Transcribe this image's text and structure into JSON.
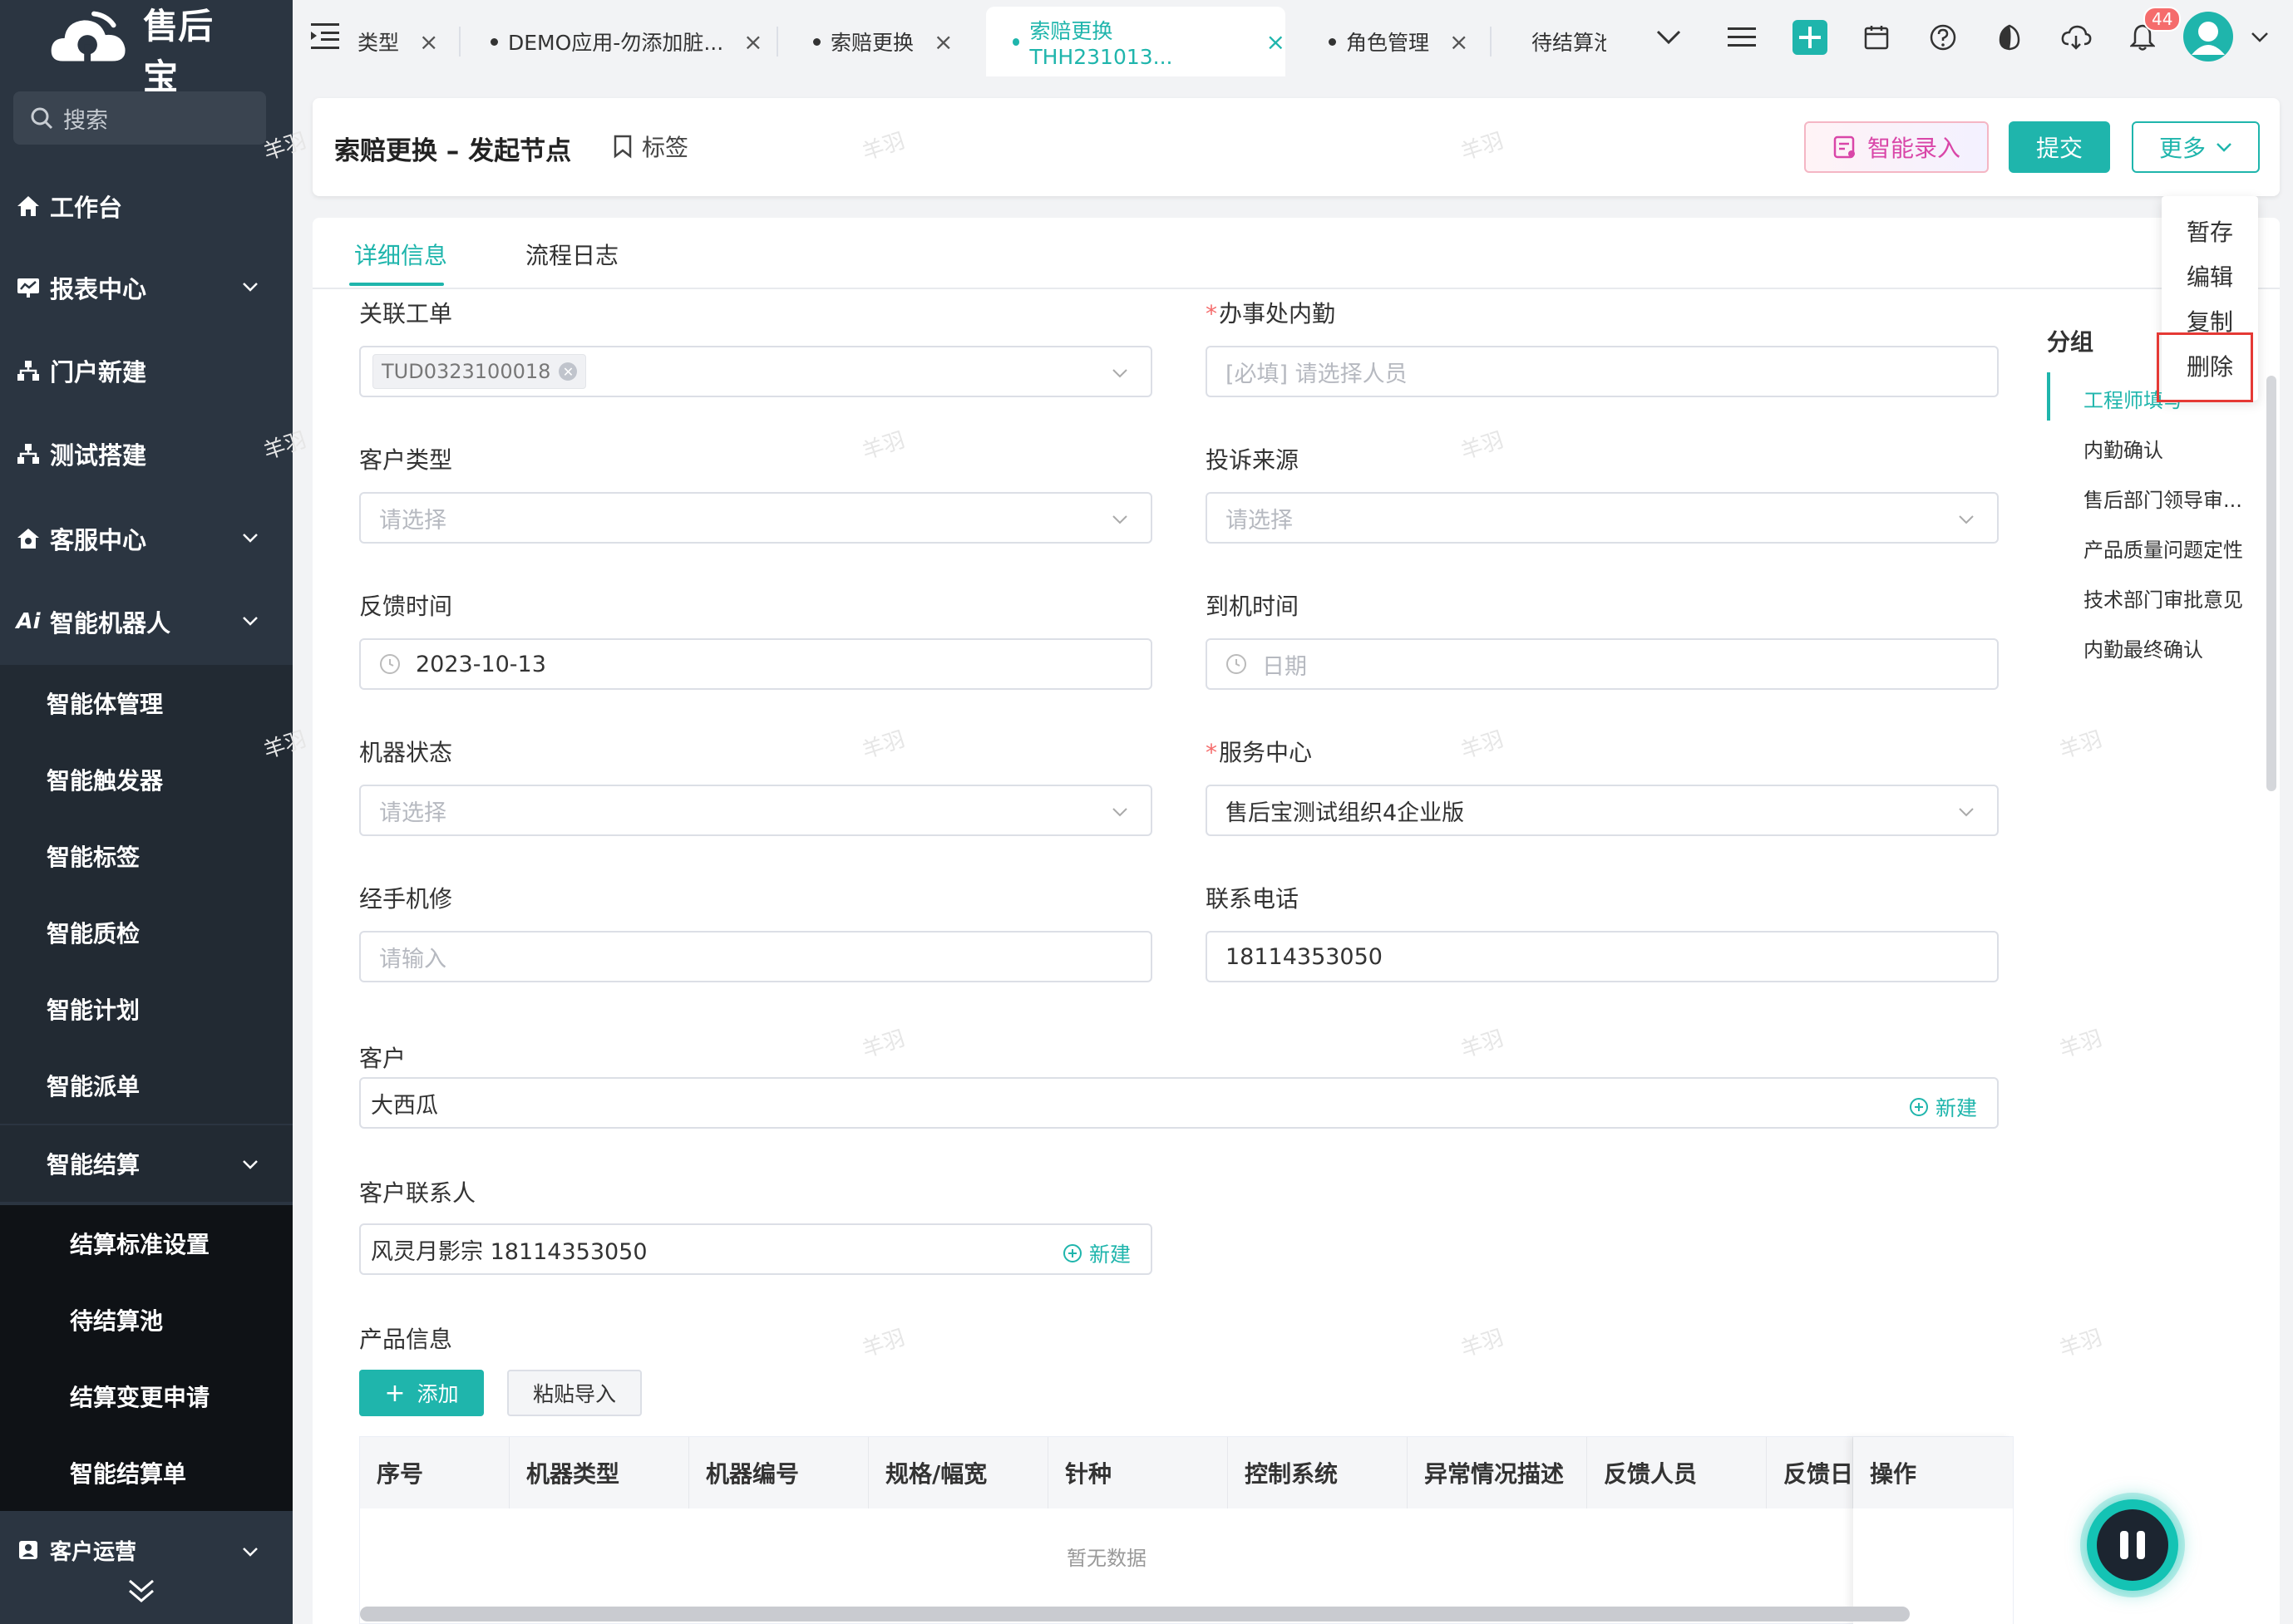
{
  "app": {
    "name": "售后宝"
  },
  "sidebar": {
    "search_label": "搜索",
    "items": [
      {
        "label": "工作台"
      },
      {
        "label": "报表中心"
      },
      {
        "label": "门户新建"
      },
      {
        "label": "测试搭建"
      },
      {
        "label": "客服中心"
      },
      {
        "label": "智能机器人"
      }
    ],
    "robot_sub": [
      "智能体管理",
      "智能触发器",
      "智能标签",
      "智能质检",
      "智能计划",
      "智能派单",
      "智能结算"
    ],
    "settle_sub": [
      "结算标准设置",
      "待结算池",
      "结算变更申请",
      "智能结算单"
    ],
    "bottom_item": "客户运营"
  },
  "tabs": [
    {
      "label": "类型"
    },
    {
      "label": "DEMO应用-勿添加脏..."
    },
    {
      "label": "索赔更换"
    },
    {
      "label": "索赔更换 THH231013..."
    },
    {
      "label": "角色管理"
    },
    {
      "label": "待结算池"
    }
  ],
  "toolbar": {
    "badge_count": "44"
  },
  "header": {
    "title": "索赔更换 – 发起节点",
    "tag_label": "标签",
    "smart_label": "智能录入",
    "submit_label": "提交",
    "more_label": "更多"
  },
  "more_menu": [
    "暂存",
    "编辑",
    "复制",
    "删除"
  ],
  "form_tabs": [
    "详细信息",
    "流程日志"
  ],
  "form": {
    "linked_order": {
      "label": "关联工单",
      "chip": "TUD0323100018"
    },
    "office_staff": {
      "label": "办事处内勤",
      "placeholder": "[必填] 请选择人员"
    },
    "customer_type": {
      "label": "客户类型",
      "placeholder": "请选择"
    },
    "complaint_source": {
      "label": "投诉来源",
      "placeholder": "请选择"
    },
    "feedback_time": {
      "label": "反馈时间",
      "value": "2023-10-13"
    },
    "arrival_time": {
      "label": "到机时间",
      "placeholder": "日期"
    },
    "machine_status": {
      "label": "机器状态",
      "placeholder": "请选择"
    },
    "service_center": {
      "label": "服务中心",
      "value": "售后宝测试组织4企业版"
    },
    "handler": {
      "label": "经手机修",
      "placeholder": "请输入"
    },
    "phone": {
      "label": "联系电话",
      "value": "18114353050"
    },
    "customer": {
      "label": "客户",
      "value": "大西瓜",
      "new_label": "新建"
    },
    "contact": {
      "label": "客户联系人",
      "value": "风灵月影宗 18114353050",
      "new_label": "新建"
    },
    "product": {
      "label": "产品信息",
      "add_label": "添加",
      "paste_label": "粘贴导入"
    }
  },
  "table": {
    "columns": [
      "序号",
      "机器类型",
      "机器编号",
      "规格/幅宽",
      "针种",
      "控制系统",
      "异常情况描述",
      "反馈人员",
      "反馈日"
    ],
    "op_column": "操作",
    "empty_text": "暂无数据"
  },
  "group_nav": {
    "title": "分组",
    "items": [
      "工程师填写",
      "内勤确认",
      "售后部门领导审...",
      "产品质量问题定性",
      "技术部门审批意见",
      "内勤最终确认"
    ]
  },
  "watermark": "羊羽",
  "colors": {
    "accent": "#1fb5ac",
    "sidebar": "#2b3541",
    "danger": "#e53935"
  }
}
